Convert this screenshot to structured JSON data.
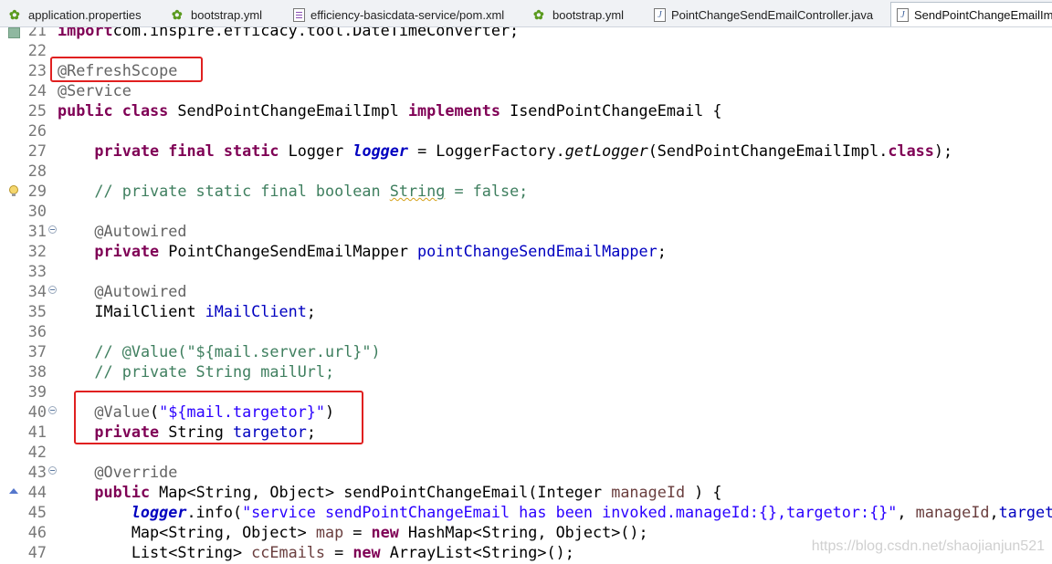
{
  "tabs": [
    {
      "label": "application.properties",
      "icon": "leaf-icon"
    },
    {
      "label": "bootstrap.yml",
      "icon": "leaf-icon"
    },
    {
      "label": "efficiency-basicdata-service/pom.xml",
      "icon": "xml-file-icon"
    },
    {
      "label": "bootstrap.yml",
      "icon": "leaf-icon"
    },
    {
      "label": "PointChangeSendEmailController.java",
      "icon": "java-file-icon"
    },
    {
      "label": "SendPointChangeEmailImp",
      "icon": "java-file-icon"
    }
  ],
  "lines": [
    {
      "n": "21",
      "tokens": [
        [
          "k",
          "import"
        ],
        [
          "",
          "com.inspire.efficacy.tool.DateTimeConverter;"
        ]
      ]
    },
    {
      "n": "22",
      "tokens": []
    },
    {
      "n": "23",
      "tokens": [
        [
          "an",
          "@RefreshScope"
        ]
      ]
    },
    {
      "n": "24",
      "tokens": [
        [
          "an",
          "@Service"
        ]
      ]
    },
    {
      "n": "25",
      "tokens": [
        [
          "k",
          "public"
        ],
        [
          "",
          " "
        ],
        [
          "k",
          "class"
        ],
        [
          "",
          " SendPointChangeEmailImpl "
        ],
        [
          "k",
          "implements"
        ],
        [
          "",
          " IsendPointChangeEmail {"
        ]
      ]
    },
    {
      "n": "26",
      "tokens": []
    },
    {
      "n": "27",
      "tokens": [
        [
          "",
          "    "
        ],
        [
          "k",
          "private"
        ],
        [
          "",
          " "
        ],
        [
          "k",
          "final"
        ],
        [
          "",
          " "
        ],
        [
          "k",
          "static"
        ],
        [
          "",
          " Logger "
        ],
        [
          "sf",
          "logger"
        ],
        [
          "",
          " = LoggerFactory."
        ],
        [
          "it",
          "getLogger"
        ],
        [
          "",
          "(SendPointChangeEmailImpl."
        ],
        [
          "k",
          "class"
        ],
        [
          "",
          ");"
        ]
      ]
    },
    {
      "n": "28",
      "tokens": []
    },
    {
      "n": "29",
      "tokens": [
        [
          "",
          "    "
        ],
        [
          "cm",
          "// private static final boolean "
        ],
        [
          "cmw",
          "String"
        ],
        [
          "cm",
          " = false;"
        ]
      ]
    },
    {
      "n": "30",
      "tokens": []
    },
    {
      "n": "31",
      "tokens": [
        [
          "",
          "    "
        ],
        [
          "an",
          "@Autowired"
        ]
      ],
      "fold": true
    },
    {
      "n": "32",
      "tokens": [
        [
          "",
          "    "
        ],
        [
          "k",
          "private"
        ],
        [
          "",
          " PointChangeSendEmailMapper "
        ],
        [
          "fd",
          "pointChangeSendEmailMapper"
        ],
        [
          "",
          ";"
        ]
      ]
    },
    {
      "n": "33",
      "tokens": []
    },
    {
      "n": "34",
      "tokens": [
        [
          "",
          "    "
        ],
        [
          "an",
          "@Autowired"
        ]
      ],
      "fold": true
    },
    {
      "n": "35",
      "tokens": [
        [
          "",
          "    IMailClient "
        ],
        [
          "fd",
          "iMailClient"
        ],
        [
          "",
          ";"
        ]
      ]
    },
    {
      "n": "36",
      "tokens": []
    },
    {
      "n": "37",
      "tokens": [
        [
          "",
          "    "
        ],
        [
          "cm",
          "// @Value(\"${mail.server.url}\")"
        ]
      ]
    },
    {
      "n": "38",
      "tokens": [
        [
          "",
          "    "
        ],
        [
          "cm",
          "// private String mailUrl;"
        ]
      ]
    },
    {
      "n": "39",
      "tokens": []
    },
    {
      "n": "40",
      "tokens": [
        [
          "",
          "    "
        ],
        [
          "an",
          "@Value"
        ],
        [
          "",
          "("
        ],
        [
          "st",
          "\"${mail.targetor}\""
        ],
        [
          "",
          ")"
        ]
      ],
      "fold": true
    },
    {
      "n": "41",
      "tokens": [
        [
          "",
          "    "
        ],
        [
          "k",
          "private"
        ],
        [
          "",
          " String "
        ],
        [
          "fd",
          "targetor"
        ],
        [
          "",
          ";"
        ]
      ]
    },
    {
      "n": "42",
      "tokens": []
    },
    {
      "n": "43",
      "tokens": [
        [
          "",
          "    "
        ],
        [
          "an",
          "@Override"
        ]
      ],
      "fold": true
    },
    {
      "n": "44",
      "tokens": [
        [
          "",
          "    "
        ],
        [
          "k",
          "public"
        ],
        [
          "",
          " Map<String, Object> sendPointChangeEmail(Integer "
        ],
        [
          "lv",
          "manageId"
        ],
        [
          "",
          " ) {"
        ]
      ]
    },
    {
      "n": "45",
      "tokens": [
        [
          "",
          "        "
        ],
        [
          "sf",
          "logger"
        ],
        [
          "",
          ".info("
        ],
        [
          "st",
          "\"service sendPointChangeEmail has been invoked.manageId:{},targetor:{}\""
        ],
        [
          "",
          ", "
        ],
        [
          "lv",
          "manageId"
        ],
        [
          "",
          ","
        ],
        [
          "fd",
          "targeto"
        ]
      ]
    },
    {
      "n": "46",
      "tokens": [
        [
          "",
          "        Map<String, Object> "
        ],
        [
          "lv",
          "map"
        ],
        [
          "",
          " = "
        ],
        [
          "k",
          "new"
        ],
        [
          "",
          " HashMap<String, Object>();"
        ]
      ]
    },
    {
      "n": "47",
      "tokens": [
        [
          "",
          "        List<String> "
        ],
        [
          "lv",
          "ccEmails"
        ],
        [
          "",
          " = "
        ],
        [
          "k",
          "new"
        ],
        [
          "",
          " ArrayList<String>();"
        ]
      ]
    }
  ],
  "watermark": "https://blog.csdn.net/shaojianjun521"
}
